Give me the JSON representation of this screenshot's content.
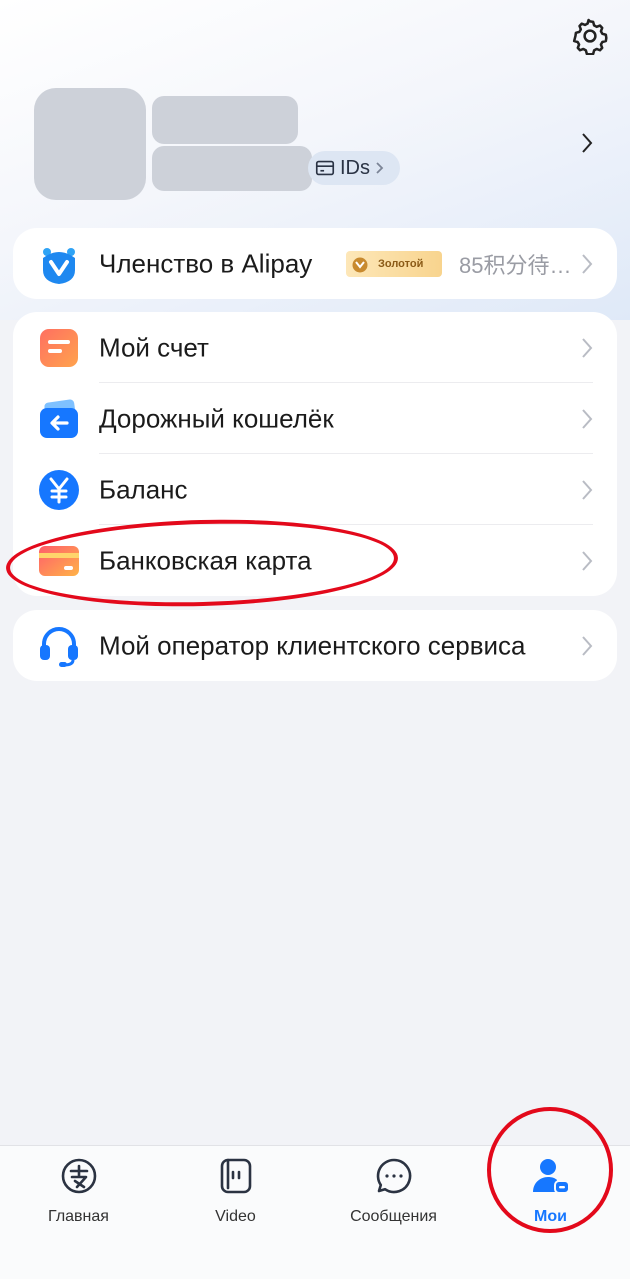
{
  "profile": {
    "ids_label": "IDs"
  },
  "membership": {
    "label": "Членство в Alipay",
    "badge": "Золотой",
    "points": "85积分待…"
  },
  "menu": {
    "account": "Мой счет",
    "travel_wallet": "Дорожный кошелёк",
    "balance": "Баланс",
    "bank_card": "Банковская карта"
  },
  "support": {
    "label": "Мой оператор клиентского сервиса"
  },
  "tabs": [
    {
      "label": "Главная",
      "icon": "alipay-home-icon"
    },
    {
      "label": "Video",
      "icon": "video-icon"
    },
    {
      "label": "Сообщения",
      "icon": "messages-icon"
    },
    {
      "label": "Мои",
      "icon": "profile-icon",
      "active": true
    }
  ],
  "colors": {
    "accent": "#1677ff",
    "annotation": "#e3091b",
    "background": "#f2f3f7"
  }
}
